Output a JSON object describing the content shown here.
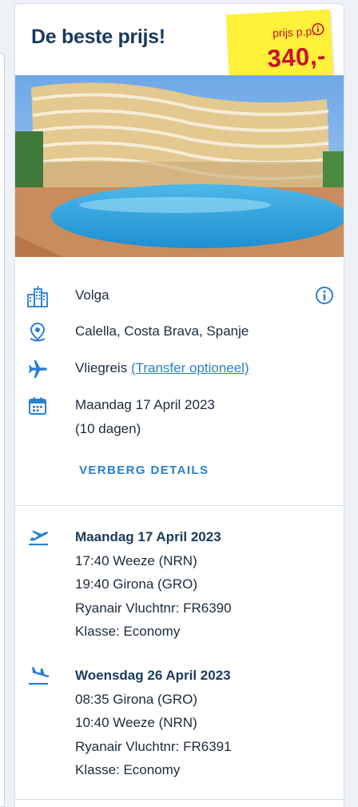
{
  "card": {
    "title": "De beste prijs!",
    "price_label": "prijs p.p.",
    "price_value": "340,-"
  },
  "hotel": {
    "name": "Volga",
    "location": "Calella, Costa Brava, Spanje",
    "travel_type_prefix": "Vliegreis",
    "transfer_link": "(Transfer optioneel)",
    "date": "Maandag 17 April 2023",
    "duration": "(10 dagen)"
  },
  "details_toggle": "VERBERG DETAILS",
  "flights": [
    {
      "date": "Maandag 17 April 2023",
      "departure": "17:40 Weeze (NRN)",
      "arrival": "19:40 Girona (GRO)",
      "carrier": "Ryanair Vluchtnr: FR6390",
      "class": "Klasse: Economy"
    },
    {
      "date": "Woensdag 26 April 2023",
      "departure": "08:35 Girona (GRO)",
      "arrival": "10:40 Weeze (NRN)",
      "carrier": "Ryanair Vluchtnr: FR6391",
      "class": "Klasse: Economy"
    }
  ],
  "icons": {
    "hotel": "building-icon",
    "location": "map-pin-icon",
    "travel": "airplane-icon",
    "date": "calendar-icon",
    "info": "info-icon",
    "outbound": "plane-departure-icon",
    "return": "plane-arrival-icon"
  },
  "colors": {
    "accent": "#2a7fd4",
    "title": "#1a3a5c",
    "price_bg": "#fff03a",
    "price_text": "#c8102e"
  }
}
